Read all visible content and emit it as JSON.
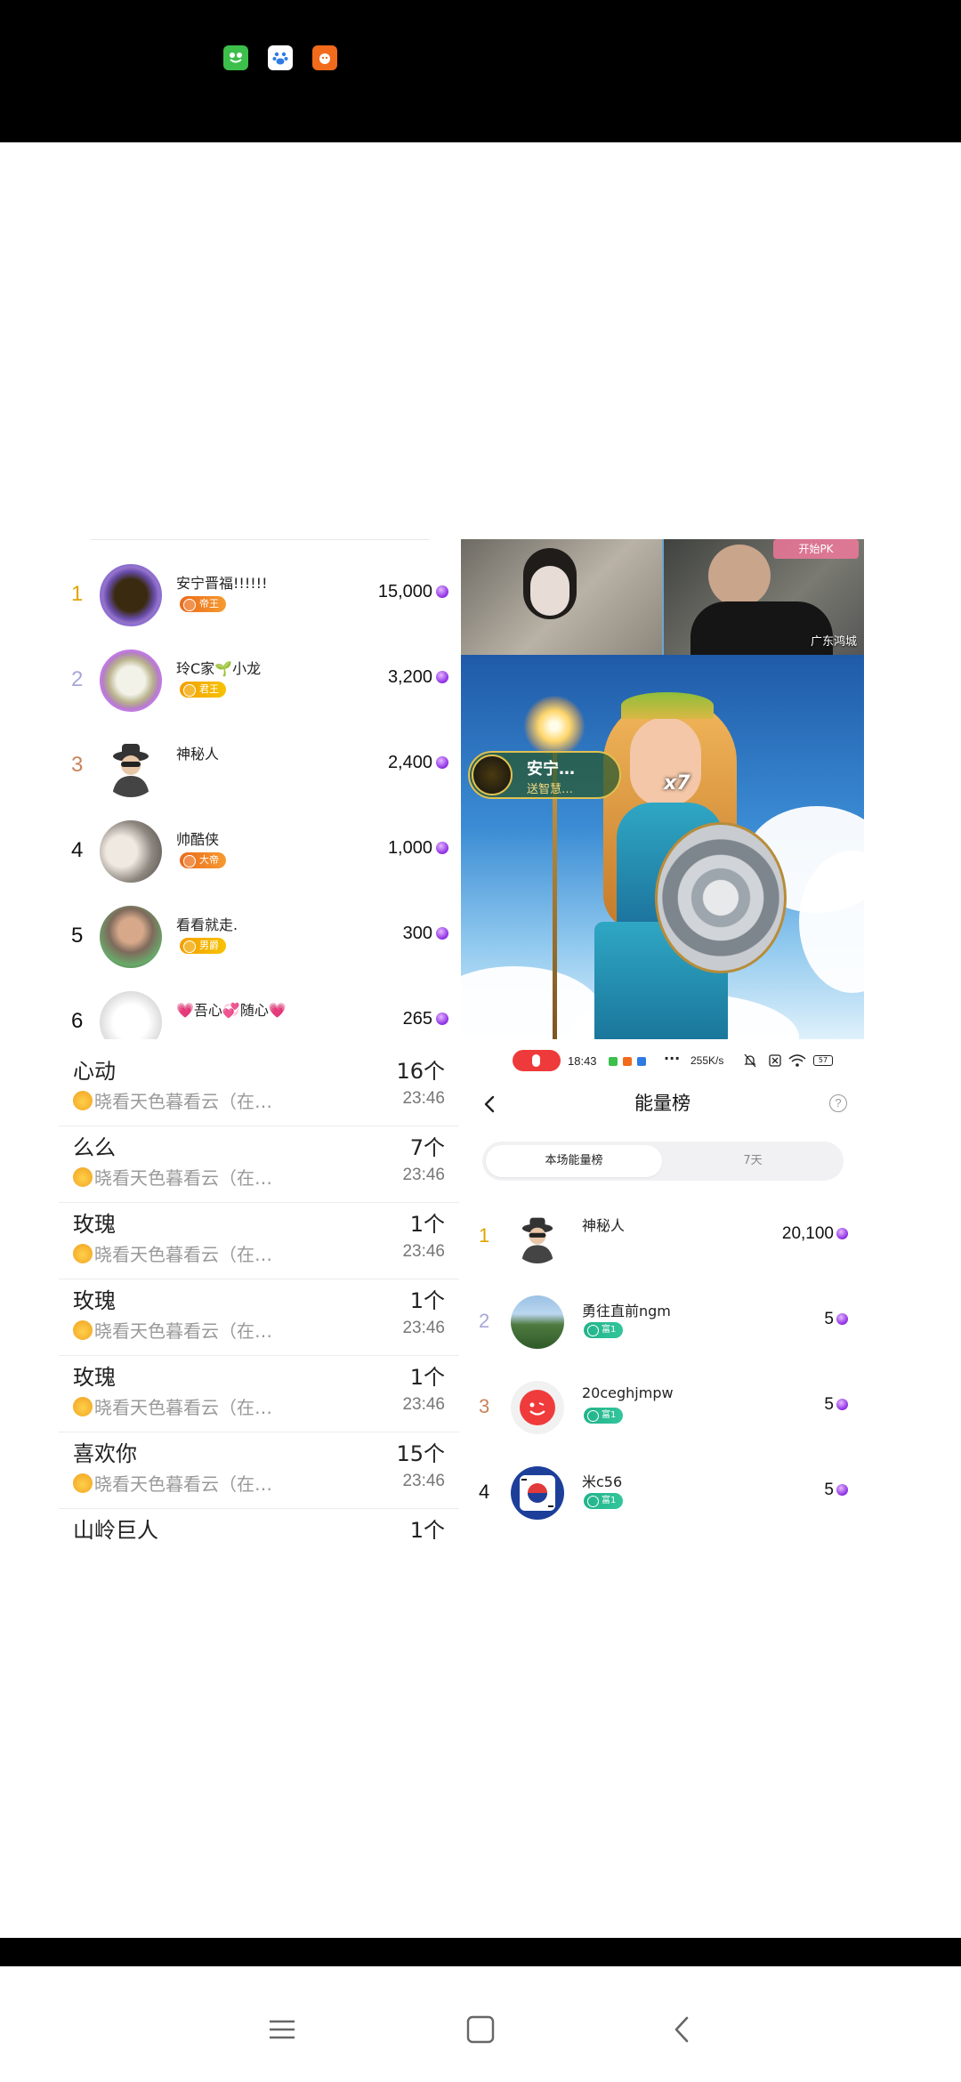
{
  "top_icons": [
    {
      "name": "frog-app-icon",
      "color": "#3cbf4b"
    },
    {
      "name": "paw-app-icon",
      "color": "#2f7be5"
    },
    {
      "name": "orange-app-icon",
      "color": "#f26a1b"
    }
  ],
  "left_ranking": {
    "rows": [
      {
        "rank": "1",
        "name": "安宁晋福!!!!!!",
        "badge": "帝王",
        "score": "15,000",
        "rank_color": "#e0a500"
      },
      {
        "rank": "2",
        "name": "玲C家🌱小龙",
        "badge": "君王",
        "score": "3,200",
        "rank_color": "#a7a7d8"
      },
      {
        "rank": "3",
        "name": "神秘人",
        "badge": "",
        "score": "2,400",
        "rank_color": "#c9845b"
      },
      {
        "rank": "4",
        "name": "帅酷侠",
        "badge": "大帝",
        "score": "1,000",
        "rank_color": "#111111"
      },
      {
        "rank": "5",
        "name": "看看就走.",
        "badge": "男爵",
        "score": "300",
        "rank_color": "#111111"
      },
      {
        "rank": "6",
        "name": "💗吾心💞随心💗",
        "badge": "",
        "score": "265",
        "rank_color": "#111111"
      }
    ]
  },
  "video": {
    "pk_button": "开始PK",
    "location_label": "广东鸿城",
    "gift_sender": "安宁…",
    "gift_text": "送智慧…",
    "gift_multiplier": "x7"
  },
  "status_bar": {
    "time": "18:43",
    "speed": "255K/s",
    "battery": "57"
  },
  "energy_ranking": {
    "title": "能量榜",
    "help": "?",
    "tabs": [
      "本场能量榜",
      "7天"
    ],
    "rows": [
      {
        "rank": "1",
        "name": "神秘人",
        "badge": "",
        "score": "20,100",
        "rank_color": "#e0a500"
      },
      {
        "rank": "2",
        "name": "勇往直前ngm",
        "badge": "富1",
        "score": "5",
        "rank_color": "#a7a7d8"
      },
      {
        "rank": "3",
        "name": "20ceghjmpw",
        "badge": "富1",
        "score": "5",
        "rank_color": "#c9845b"
      },
      {
        "rank": "4",
        "name": "米c56",
        "badge": "富1",
        "score": "5",
        "rank_color": "#111111"
      }
    ]
  },
  "gift_list": [
    {
      "name": "心动",
      "count": "16个",
      "sub": "晓看天色暮看云（在…",
      "time": "23:46"
    },
    {
      "name": "么么",
      "count": "7个",
      "sub": "晓看天色暮看云（在…",
      "time": "23:46"
    },
    {
      "name": "玫瑰",
      "count": "1个",
      "sub": "晓看天色暮看云（在…",
      "time": "23:46"
    },
    {
      "name": "玫瑰",
      "count": "1个",
      "sub": "晓看天色暮看云（在…",
      "time": "23:46"
    },
    {
      "name": "玫瑰",
      "count": "1个",
      "sub": "晓看天色暮看云（在…",
      "time": "23:46"
    },
    {
      "name": "喜欢你",
      "count": "15个",
      "sub": "晓看天色暮看云（在…",
      "time": "23:46"
    },
    {
      "name": "山岭巨人",
      "count": "1个",
      "sub": "",
      "time": ""
    }
  ]
}
